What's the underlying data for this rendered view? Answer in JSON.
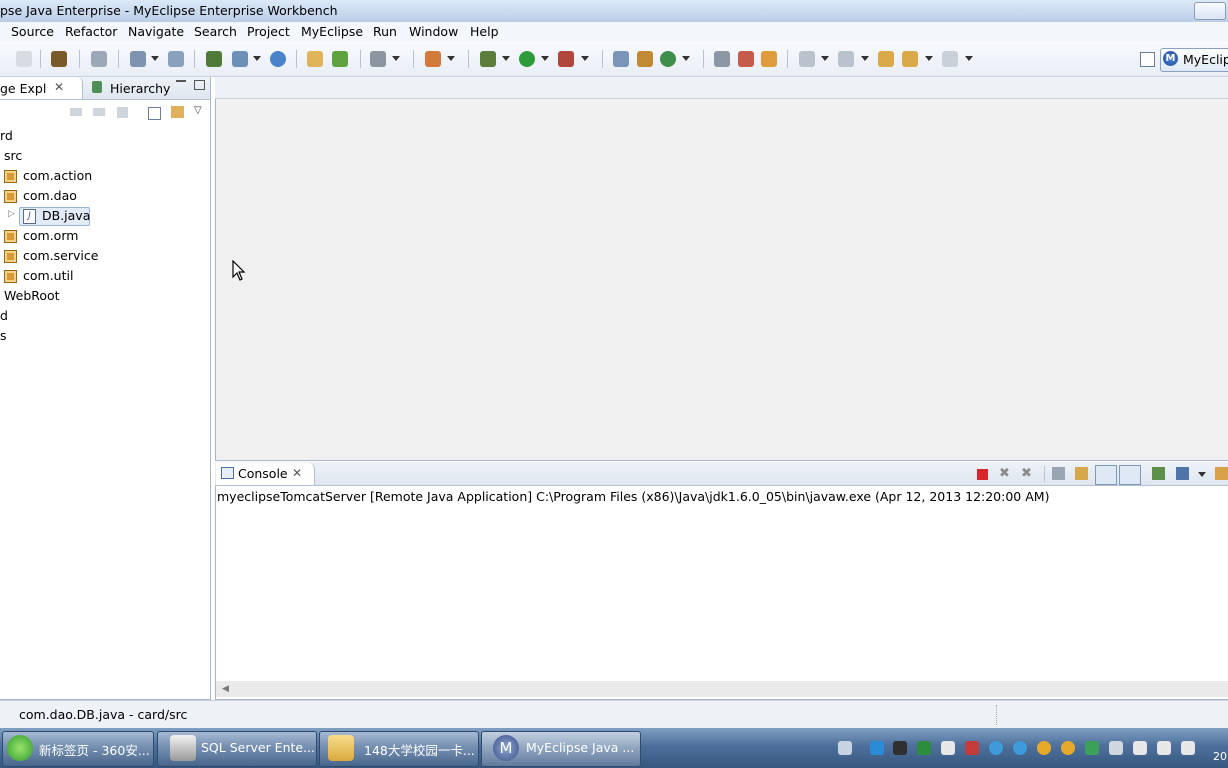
{
  "window": {
    "title": "pse Java Enterprise - MyEclipse Enterprise Workbench"
  },
  "menubar": {
    "items": [
      "Source",
      "Refactor",
      "Navigate",
      "Search",
      "Project",
      "MyEclipse",
      "Run",
      "Window",
      "Help"
    ]
  },
  "toolbar": {
    "perspective_label": "MyEclip",
    "perspective_icon_letter": "M"
  },
  "left_panel": {
    "tabs": [
      "ge Expl",
      "Hierarchy"
    ],
    "tree": [
      {
        "label": "rd",
        "icon": "project-icon"
      },
      {
        "label": "src",
        "icon": "source-folder-icon"
      },
      {
        "label": "com.action",
        "icon": "package-icon"
      },
      {
        "label": "com.dao",
        "icon": "package-icon"
      },
      {
        "label": "DB.java",
        "icon": "java-file-icon",
        "selected": true
      },
      {
        "label": "com.orm",
        "icon": "package-icon"
      },
      {
        "label": "com.service",
        "icon": "package-icon"
      },
      {
        "label": "com.util",
        "icon": "package-icon"
      },
      {
        "label": "WebRoot",
        "icon": "folder-icon"
      },
      {
        "label": "d",
        "icon": "project-icon"
      },
      {
        "label": "s",
        "icon": "project-icon"
      }
    ]
  },
  "console": {
    "tab_label": "Console",
    "description": "myeclipseTomcatServer [Remote Java Application] C:\\Program Files (x86)\\Java\\jdk1.6.0_05\\bin\\javaw.exe (Apr 12, 2013 12:20:00 AM)"
  },
  "statusbar": {
    "text": "com.dao.DB.java - card/src"
  },
  "taskbar": {
    "buttons": [
      {
        "label": "新标签页 - 360安...",
        "icon": "360-browser-icon"
      },
      {
        "label": "SQL Server Ente...",
        "icon": "sql-server-icon"
      },
      {
        "label": "148大学校园一卡...",
        "icon": "folder-icon"
      },
      {
        "label": "MyEclipse Java ...",
        "icon": "myeclipse-icon",
        "active": true
      }
    ],
    "clock": "20"
  }
}
